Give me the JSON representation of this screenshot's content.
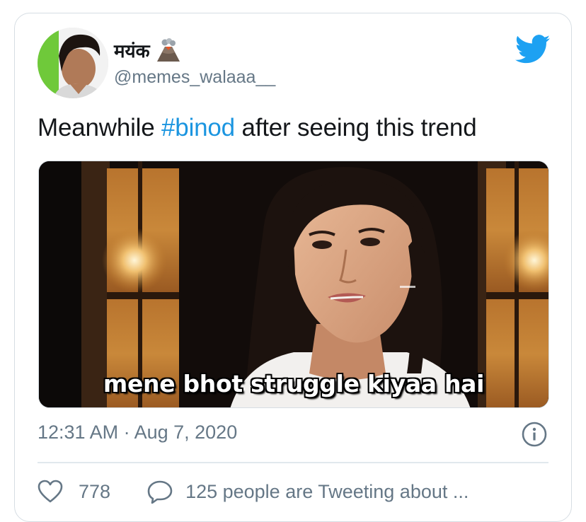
{
  "author": {
    "display_name": "मयंक",
    "handle": "@memes_walaaa__",
    "avatar_icon": "profile-photo",
    "name_emoji_icon": "volcano-icon"
  },
  "platform_icon": "twitter-bird-icon",
  "tweet": {
    "text_before": "Meanwhile ",
    "hashtag": "#binod",
    "text_after": " after seeing this trend"
  },
  "media": {
    "caption": "mene bhot struggle kiyaa hai"
  },
  "meta": {
    "timestamp": "12:31 AM · Aug 7, 2020",
    "info_icon": "info-icon"
  },
  "actions": {
    "likes_count": "778",
    "like_icon": "heart-icon",
    "reply_icon": "speech-bubble-icon",
    "tweeting_about": "125 people are Tweeting about ..."
  },
  "colors": {
    "link": "#1b95e0",
    "secondary_text": "#657786",
    "border": "#d6dde3",
    "twitter_blue": "#1da1f2"
  }
}
